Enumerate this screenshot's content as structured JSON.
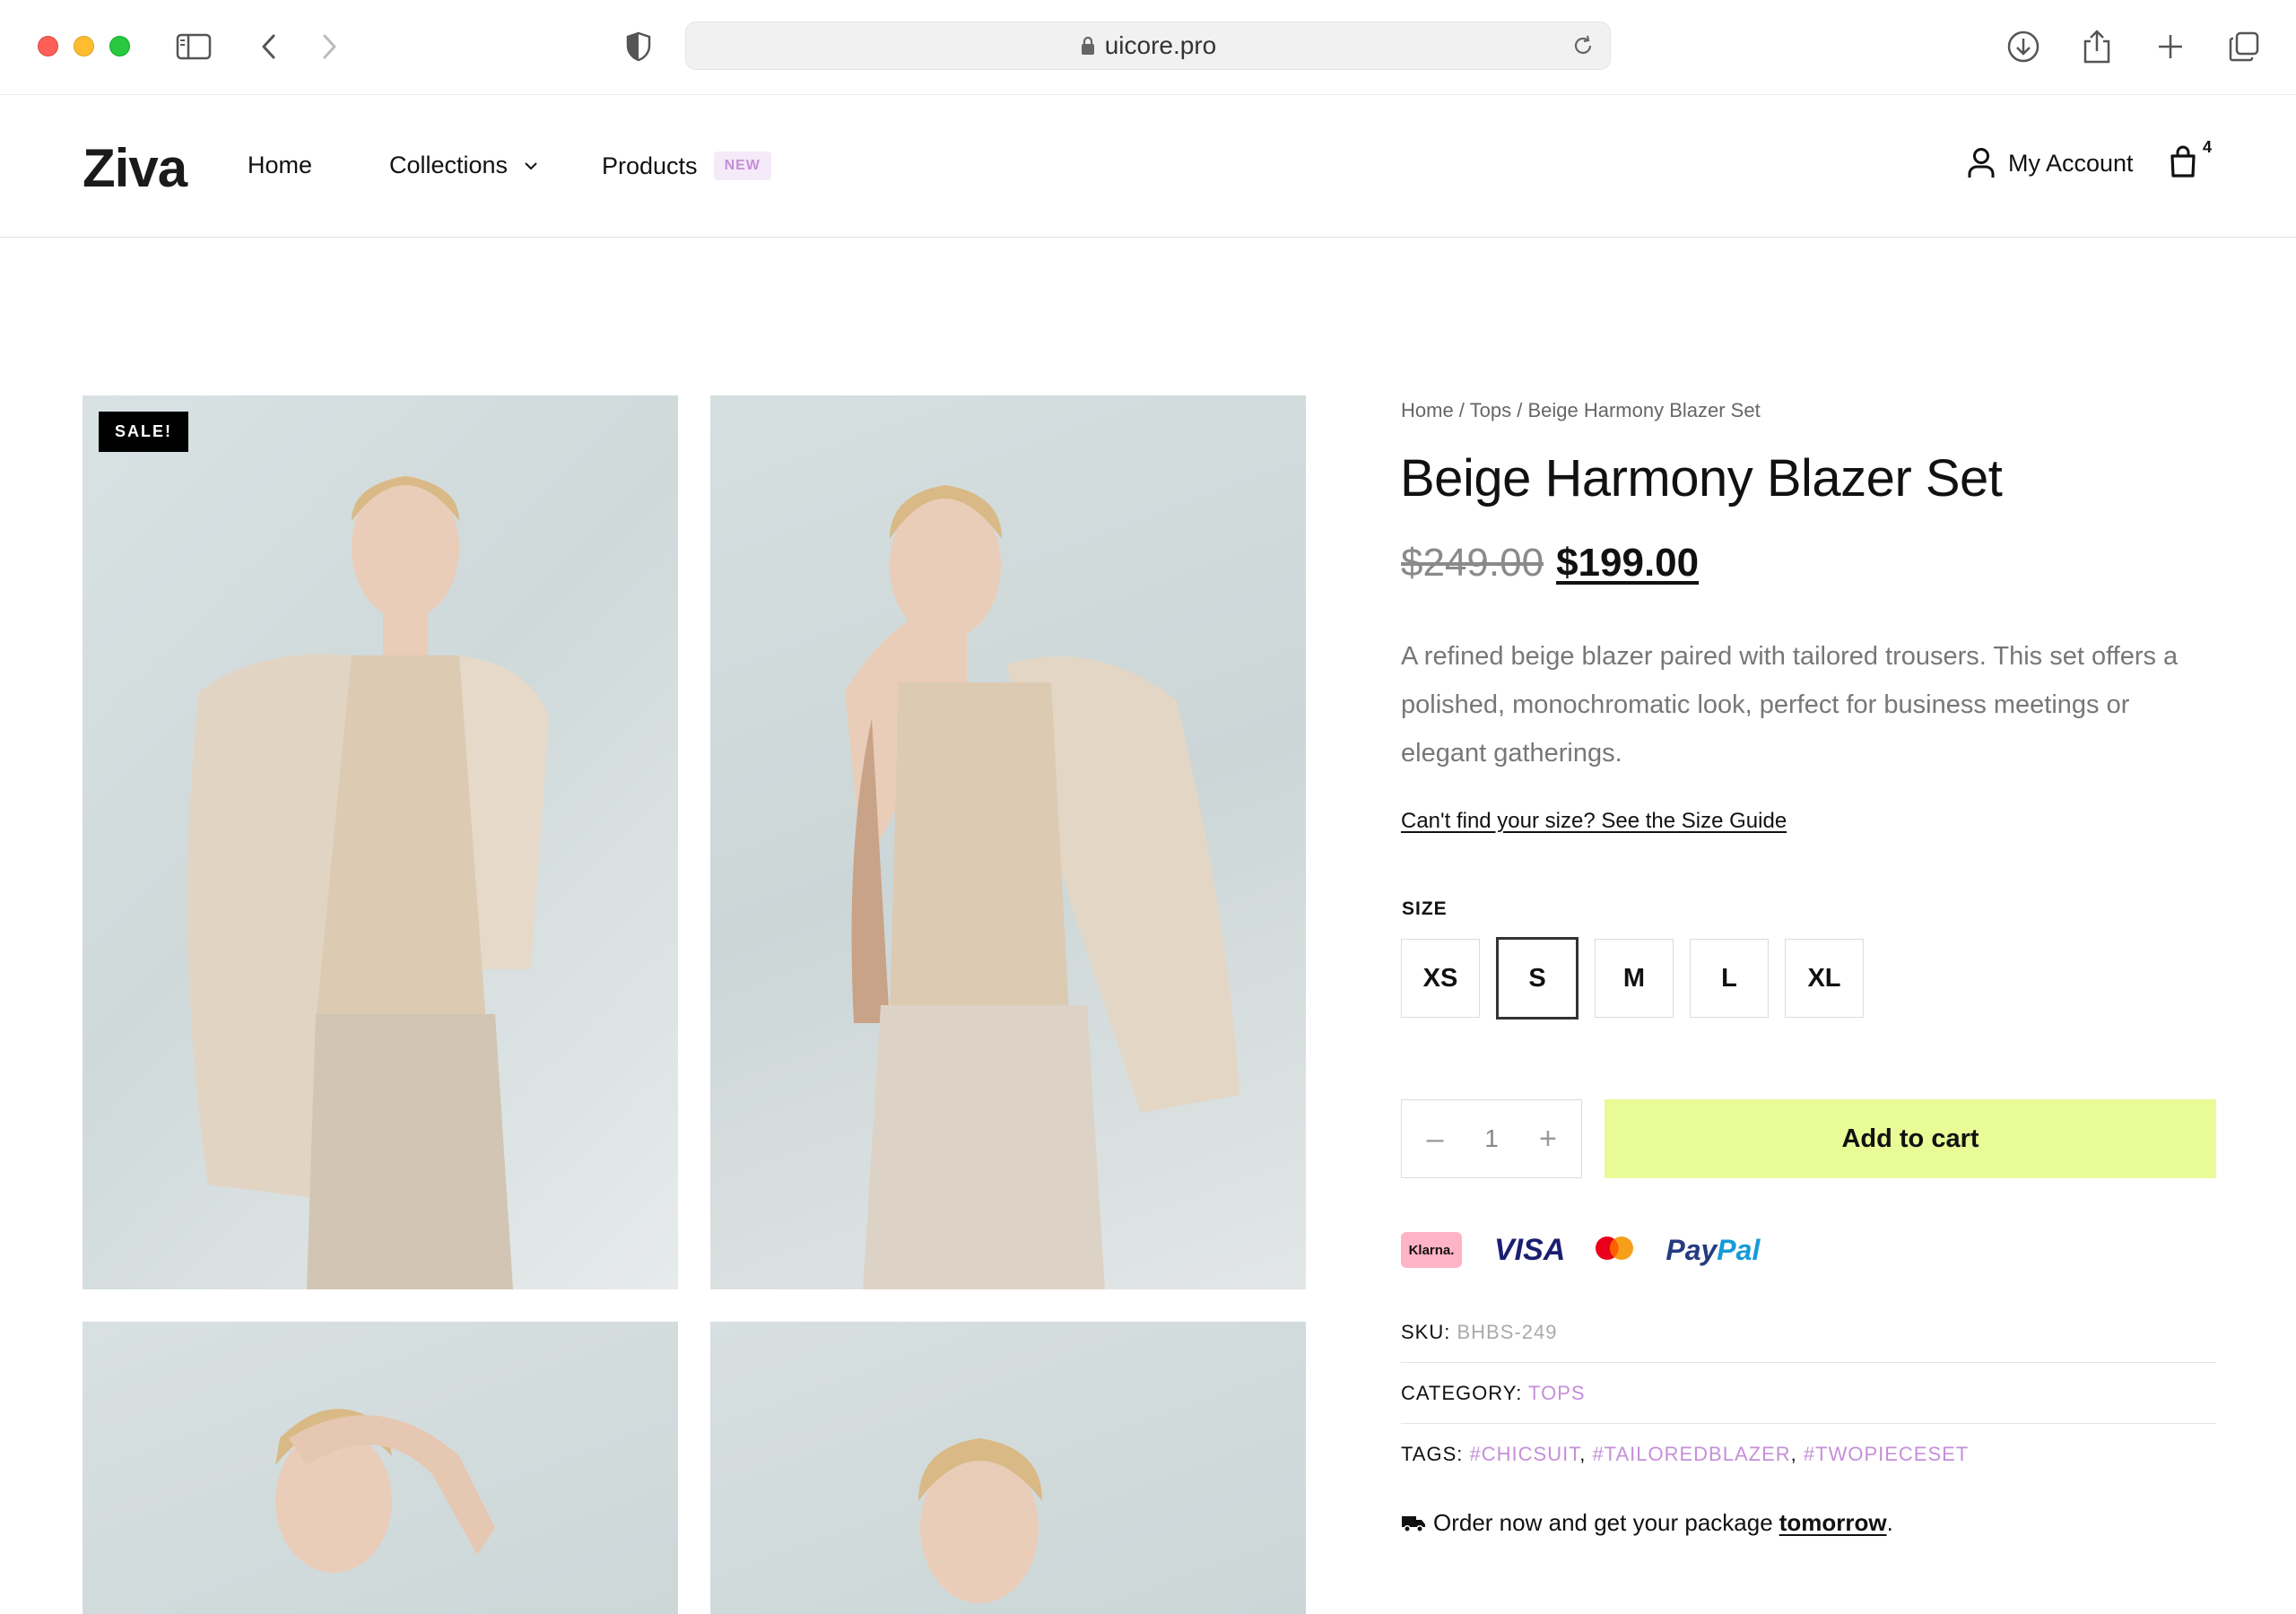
{
  "browser": {
    "url": "uicore.pro"
  },
  "site": {
    "logo": "Ziva",
    "nav": {
      "home": "Home",
      "collections": "Collections",
      "products": "Products",
      "products_badge": "NEW"
    },
    "account_label": "My Account",
    "cart_count": "4"
  },
  "gallery": {
    "sale_badge": "SALE!"
  },
  "product": {
    "breadcrumb": [
      "Home",
      "Tops",
      "Beige Harmony Blazer Set"
    ],
    "title": "Beige Harmony Blazer Set",
    "price_old": "$249.00",
    "price_new": "$199.00",
    "description": "A refined beige blazer paired with tailored trousers. This set offers a polished, monochromatic look, perfect for business meetings or elegant gatherings.",
    "size_guide": "Can't find your size? See the Size Guide",
    "size_label": "SIZE",
    "sizes": [
      "XS",
      "S",
      "M",
      "L",
      "XL"
    ],
    "selected_size": "S",
    "quantity": "1",
    "qty_minus": "–",
    "qty_plus": "+",
    "add_to_cart": "Add to cart",
    "payments": {
      "klarna": "Klarna.",
      "visa": "VISA",
      "paypal_a": "Pay",
      "paypal_b": "Pal"
    },
    "sku_label": "SKU:",
    "sku": "BHBS-249",
    "category_label": "CATEGORY:",
    "category": "TOPS",
    "tags_label": "TAGS:",
    "tags": [
      "#CHICSUIT",
      "#TAILOREDBLAZER",
      "#TWOPIECESET"
    ],
    "delivery_text": "Order now and get your package",
    "delivery_strong": "tomorrow",
    "delivery_end": "."
  },
  "colors": {
    "accent_button": "#e8fb97",
    "tag_purple": "#c58fd8",
    "badge_bg": "#f5eaf8"
  }
}
